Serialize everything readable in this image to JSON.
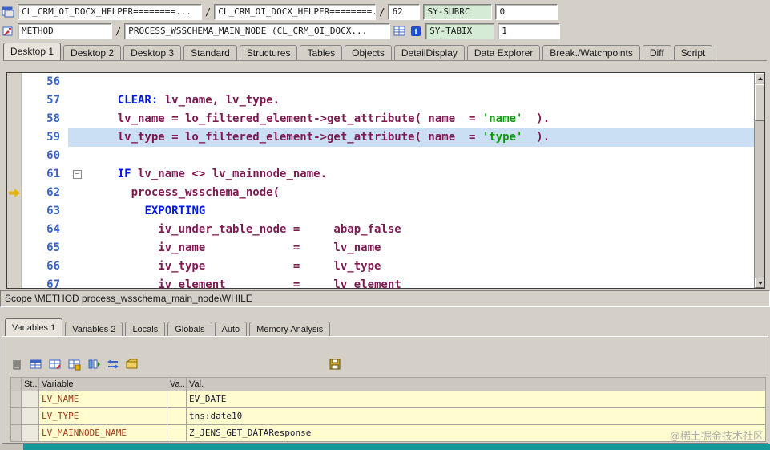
{
  "topbar": {
    "sep": "/",
    "row1": {
      "class_field": "CL_CRM_OI_DOCX_HELPER========...",
      "class_field2": "CL_CRM_OI_DOCX_HELPER========...",
      "line_number": "62",
      "sy_subrc_label": "SY-SUBRC",
      "sy_subrc_value": "0"
    },
    "row2": {
      "kind_field": "METHOD",
      "method_field": "PROCESS_WSSCHEMA_MAIN_NODE (CL_CRM_OI_DOCX...",
      "sy_tabix_label": "SY-TABIX",
      "sy_tabix_value": "1"
    }
  },
  "desktop_tabs": [
    {
      "label": "Desktop 1",
      "active": true
    },
    {
      "label": "Desktop 2",
      "active": false
    },
    {
      "label": "Desktop 3",
      "active": false
    },
    {
      "label": "Standard",
      "active": false
    },
    {
      "label": "Structures",
      "active": false
    },
    {
      "label": "Tables",
      "active": false
    },
    {
      "label": "Objects",
      "active": false
    },
    {
      "label": "DetailDisplay",
      "active": false
    },
    {
      "label": "Data Explorer",
      "active": false
    },
    {
      "label": "Break./Watchpoints",
      "active": false
    },
    {
      "label": "Diff",
      "active": false
    },
    {
      "label": "Script",
      "active": false
    }
  ],
  "code": {
    "lines": [
      {
        "num": "56",
        "seg": []
      },
      {
        "num": "57",
        "seg": [
          {
            "t": "    ",
            "c": "id"
          },
          {
            "t": "CLEAR:",
            "c": "kw"
          },
          {
            "t": " lv_name, lv_type.",
            "c": "id"
          }
        ]
      },
      {
        "num": "58",
        "seg": [
          {
            "t": "    lv_name = lo_filtered_element->get_attribute( name  = ",
            "c": "id"
          },
          {
            "t": "'name'",
            "c": "str"
          },
          {
            "t": "  ).",
            "c": "id"
          }
        ]
      },
      {
        "num": "59",
        "highlight": true,
        "seg": [
          {
            "t": "    lv_type = lo_filtered_element->get_attribute( name  = ",
            "c": "id"
          },
          {
            "t": "'type'",
            "c": "str"
          },
          {
            "t": "  ).",
            "c": "id"
          }
        ]
      },
      {
        "num": "60",
        "seg": []
      },
      {
        "num": "61",
        "fold": true,
        "seg": [
          {
            "t": "    ",
            "c": "id"
          },
          {
            "t": "IF",
            "c": "kw"
          },
          {
            "t": " lv_name <> lv_mainnode_name.",
            "c": "id"
          }
        ]
      },
      {
        "num": "62",
        "arrow": true,
        "seg": [
          {
            "t": "      process_wsschema_node(",
            "c": "id"
          }
        ]
      },
      {
        "num": "63",
        "seg": [
          {
            "t": "        ",
            "c": "id"
          },
          {
            "t": "EXPORTING",
            "c": "kw"
          }
        ]
      },
      {
        "num": "64",
        "seg": [
          {
            "t": "          iv_under_table_node =     abap_false",
            "c": "id"
          }
        ]
      },
      {
        "num": "65",
        "seg": [
          {
            "t": "          iv_name             =     lv_name",
            "c": "id"
          }
        ]
      },
      {
        "num": "66",
        "seg": [
          {
            "t": "          iv_type             =     lv_type",
            "c": "id"
          }
        ]
      },
      {
        "num": "67",
        "seg": [
          {
            "t": "          iv_element          =     lv_element",
            "c": "id"
          }
        ]
      }
    ]
  },
  "scope_text": "Scope \\METHOD process_wsschema_main_node\\WHILE",
  "variables_panel": {
    "tabs": [
      {
        "label": "Variables 1",
        "active": true
      },
      {
        "label": "Variables 2",
        "active": false
      },
      {
        "label": "Locals",
        "active": false
      },
      {
        "label": "Globals",
        "active": false
      },
      {
        "label": "Auto",
        "active": false
      },
      {
        "label": "Memory Analysis",
        "active": false
      }
    ],
    "table": {
      "headers": {
        "st": "St..",
        "variable": "Variable",
        "va": "Va..",
        "val": "Val."
      },
      "rows": [
        {
          "variable": "LV_NAME",
          "val": "EV_DATE"
        },
        {
          "variable": "LV_TYPE",
          "val": "tns:date10"
        },
        {
          "variable": "LV_MAINNODE_NAME",
          "val": "Z_JENS_GET_DATAResponse"
        }
      ]
    }
  },
  "watermark": "@稀土掘金技术社区"
}
